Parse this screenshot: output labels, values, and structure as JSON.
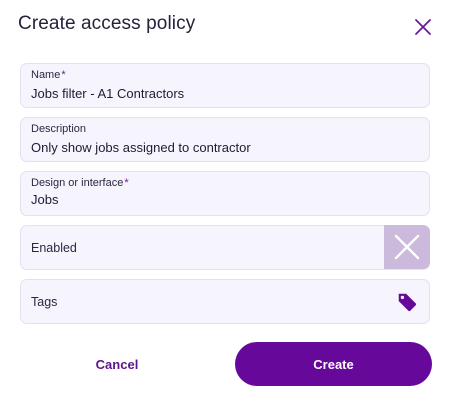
{
  "dialog": {
    "title": "Create access policy",
    "close_icon": "close-icon"
  },
  "fields": {
    "name": {
      "label": "Name",
      "required_mark": "*",
      "value": "Jobs filter - A1 Contractors"
    },
    "description": {
      "label": "Description",
      "value": "Only show jobs assigned to contractor"
    },
    "design": {
      "label": "Design or interface",
      "required_mark": "*",
      "value": "Jobs"
    },
    "enabled": {
      "label": "Enabled",
      "state": "off",
      "toggle_icon": "x-icon"
    },
    "tags": {
      "label": "Tags",
      "icon": "tag-icon"
    }
  },
  "actions": {
    "cancel_label": "Cancel",
    "create_label": "Create"
  },
  "colors": {
    "accent": "#660899",
    "toggle_off_bg": "#cbbadb",
    "field_bg": "#f6f5fd",
    "field_border": "#e3e1f1"
  }
}
